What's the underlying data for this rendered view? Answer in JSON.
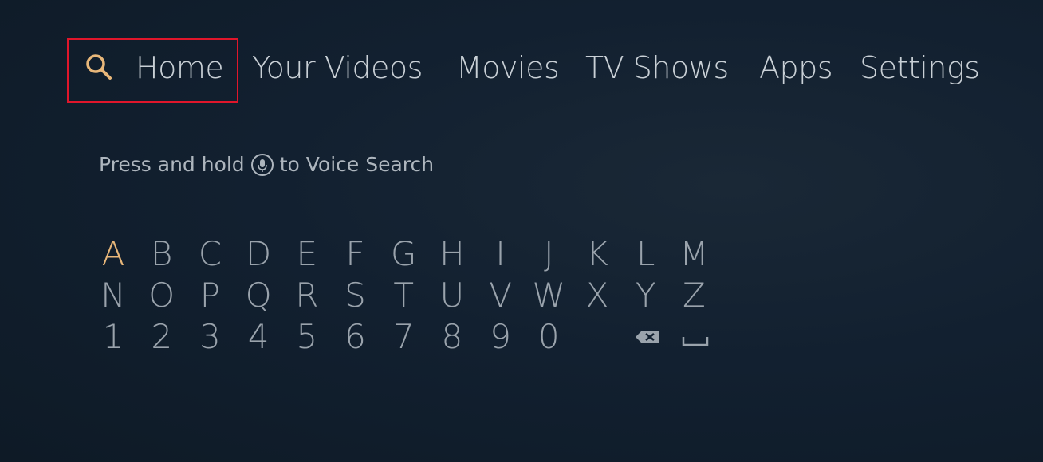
{
  "nav": {
    "search_icon": "search-icon",
    "items": [
      {
        "label": "Home"
      },
      {
        "label": "Your Videos"
      },
      {
        "label": "Movies"
      },
      {
        "label": "TV Shows"
      },
      {
        "label": "Apps"
      },
      {
        "label": "Settings"
      }
    ],
    "focused": "Home"
  },
  "voice": {
    "before": "Press and hold",
    "icon": "microphone-icon",
    "after": "to Voice Search"
  },
  "keyboard": {
    "rows": [
      [
        "A",
        "B",
        "C",
        "D",
        "E",
        "F",
        "G",
        "H",
        "I",
        "J",
        "K",
        "L",
        "M"
      ],
      [
        "N",
        "O",
        "P",
        "Q",
        "R",
        "S",
        "T",
        "U",
        "V",
        "W",
        "X",
        "Y",
        "Z"
      ],
      [
        "1",
        "2",
        "3",
        "4",
        "5",
        "6",
        "7",
        "8",
        "9",
        "0"
      ]
    ],
    "special_keys": [
      "backspace-icon",
      "space-icon"
    ],
    "selected_key": "A"
  },
  "colors": {
    "accent": "#e8b77a",
    "focus_border": "#e0162b",
    "background": "#122030"
  }
}
